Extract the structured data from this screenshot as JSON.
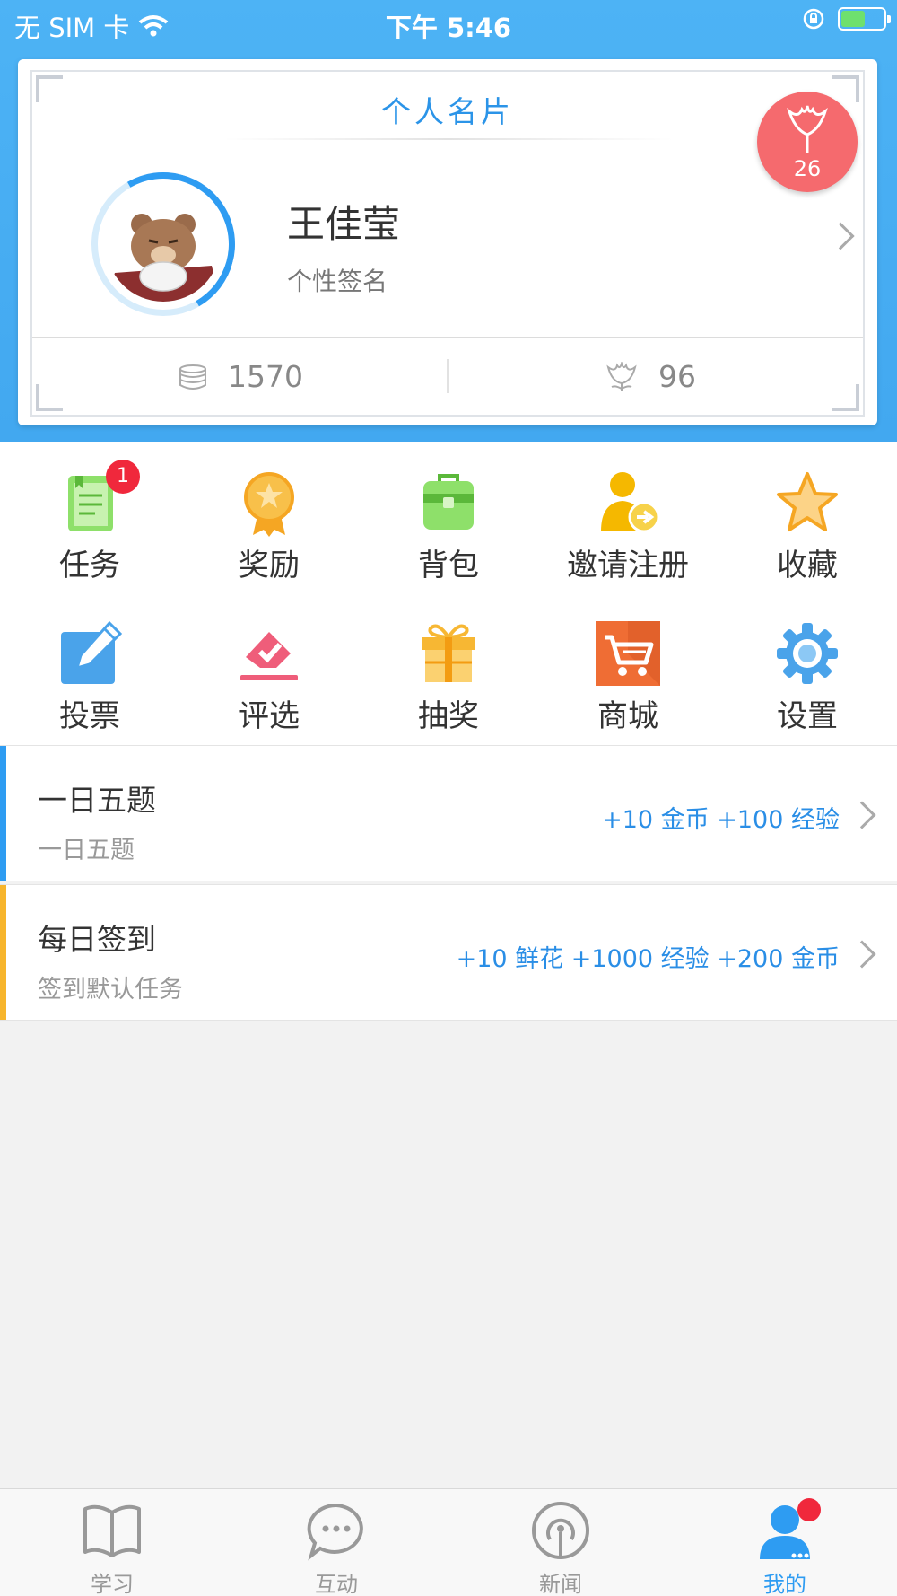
{
  "status_bar": {
    "carrier": "无 SIM 卡",
    "time": "下午 5:46"
  },
  "profile_card": {
    "title": "个人名片",
    "name": "王佳莹",
    "signature": "个性签名",
    "flower_badge_count": "26",
    "coins": "1570",
    "flowers": "96"
  },
  "grid": [
    {
      "label": "任务",
      "icon": "task-clipboard-icon",
      "badge": "1",
      "color": "#7ed957"
    },
    {
      "label": "奖励",
      "icon": "award-medal-icon",
      "color": "#f5a623"
    },
    {
      "label": "背包",
      "icon": "backpack-icon",
      "color": "#6fcf5e"
    },
    {
      "label": "邀请注册",
      "icon": "invite-user-icon",
      "color": "#f5b800"
    },
    {
      "label": "收藏",
      "icon": "star-icon",
      "color": "#f5a623"
    },
    {
      "label": "投票",
      "icon": "vote-pencil-icon",
      "color": "#3a9be8"
    },
    {
      "label": "评选",
      "icon": "ballot-check-icon",
      "color": "#ef5d7a"
    },
    {
      "label": "抽奖",
      "icon": "gift-icon",
      "color": "#f7b733"
    },
    {
      "label": "商城",
      "icon": "shopping-cart-icon",
      "color": "#f07a38"
    },
    {
      "label": "设置",
      "icon": "gear-icon",
      "color": "#3a9be8"
    }
  ],
  "tasks": [
    {
      "name": "一日五题",
      "desc": "一日五题",
      "reward": "+10 金币  +100 经验",
      "accent": "#2e9cf2"
    },
    {
      "name": "每日签到",
      "desc": "签到默认任务",
      "reward": "+10 鲜花  +1000 经验  +200 金币",
      "accent": "#f7b52c"
    }
  ],
  "tabbar": [
    {
      "label": "学习",
      "icon": "open-book-icon"
    },
    {
      "label": "互动",
      "icon": "chat-bubble-icon"
    },
    {
      "label": "新闻",
      "icon": "broadcast-icon"
    },
    {
      "label": "我的",
      "icon": "user-profile-icon",
      "active": true
    }
  ]
}
